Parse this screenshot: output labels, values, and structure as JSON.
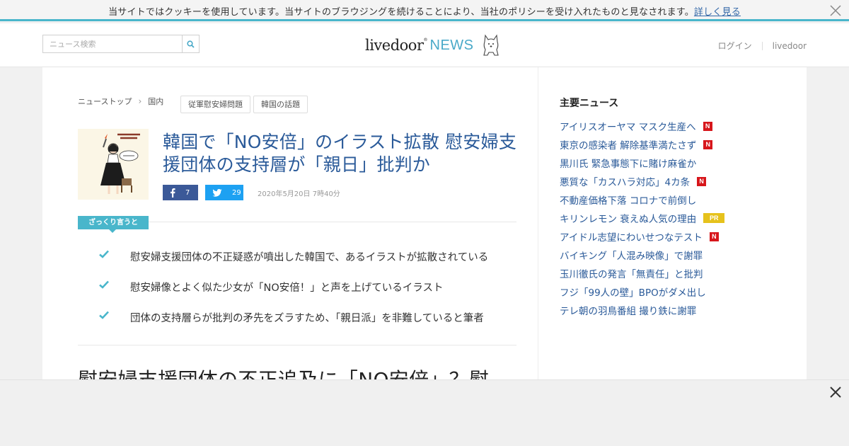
{
  "cookie_bar": {
    "text": "当サイトではクッキーを使用しています。当サイトのブラウジングを続けることにより、当社のポリシーを受け入れたものと見なされます。",
    "link": "詳しく見る",
    "close_icon": "close-icon"
  },
  "header": {
    "search_placeholder": "ニュース検索",
    "logo_main": "livedoor",
    "logo_reg": "®",
    "logo_news": "NEWS",
    "login": "ログイン",
    "livedoor": "livedoor",
    "accent_color": "#49b6cb"
  },
  "article": {
    "breadcrumb": [
      "ニューストップ",
      "国内"
    ],
    "tags": [
      "従軍慰安婦問題",
      "韓国の話題"
    ],
    "title": "韓国で「NO安倍」のイラスト拡散 慰安婦支援団体の支持層が「親日」批判か",
    "facebook_count": "7",
    "twitter_count": "29",
    "date": "2020年5月20日 7時40分",
    "summary_label": "ざっくり言うと",
    "points": [
      "慰安婦支援団体の不正疑惑が噴出した韓国で、あるイラストが拡散されている",
      "慰安婦像とよく似た少女が「NO安倍！」と声を上げているイラスト",
      "団体の支持層らが批判の矛先をズラすため、「親日派」を非難していると筆者"
    ],
    "subhead": "慰安婦支援団体の不正追及に「NO安倍」？慰"
  },
  "sidebar": {
    "title": "主要ニュース",
    "items": [
      {
        "text": "アイリスオーヤマ マスク生産へ",
        "badge": "N"
      },
      {
        "text": "東京の感染者 解除基準満たさず",
        "badge": "N"
      },
      {
        "text": "黒川氏 緊急事態下に賭け麻雀か",
        "badge": ""
      },
      {
        "text": "悪質な「カスハラ対応」4カ条",
        "badge": "N"
      },
      {
        "text": "不動産価格下落 コロナで前倒し",
        "badge": ""
      },
      {
        "text": "キリンレモン 衰えぬ人気の理由",
        "badge": "PR"
      },
      {
        "text": "アイドル志望にわいせつなテスト",
        "badge": "N"
      },
      {
        "text": "バイキング「人混み映像」で謝罪",
        "badge": ""
      },
      {
        "text": "玉川徹氏の発言「無責任」と批判",
        "badge": ""
      },
      {
        "text": "フジ「99人の壁」BPOがダメ出し",
        "badge": ""
      },
      {
        "text": "テレ朝の羽鳥番組 撮り鉄に謝罪",
        "badge": ""
      }
    ]
  }
}
